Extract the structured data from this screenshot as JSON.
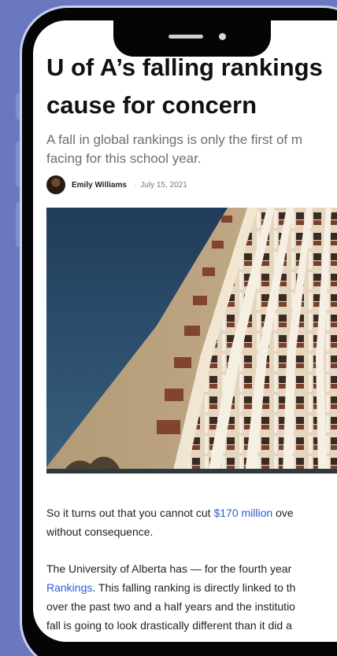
{
  "article": {
    "headline_line1": "U of A’s falling rankings",
    "headline_line2": "cause for concern",
    "subhead_line1": "A fall in global rankings is only the first of m",
    "subhead_line2": "facing for this school year.",
    "author": "Emily Williams",
    "separator": "·",
    "date": "July 15, 2021",
    "p1": {
      "pre": "So it turns out that you cannot cut ",
      "link": "$170 million",
      "post": " ove",
      "line2": "without consequence."
    },
    "p2": {
      "line1": "The University of Alberta has — for the fourth year",
      "line2_link": "Rankings",
      "line2_post": ". This falling ranking is directly linked to th",
      "line3": "over the past two and a half years and the institutio",
      "line4": "fall is going to look drastically different than it did a"
    }
  },
  "colors": {
    "background": "#6a78c0",
    "phone_frame": "#050505",
    "link": "#2f5bd6",
    "sky": "#2c4c6c"
  },
  "icons": {
    "avatar": "author-avatar-photo",
    "hero": "building-photo"
  }
}
